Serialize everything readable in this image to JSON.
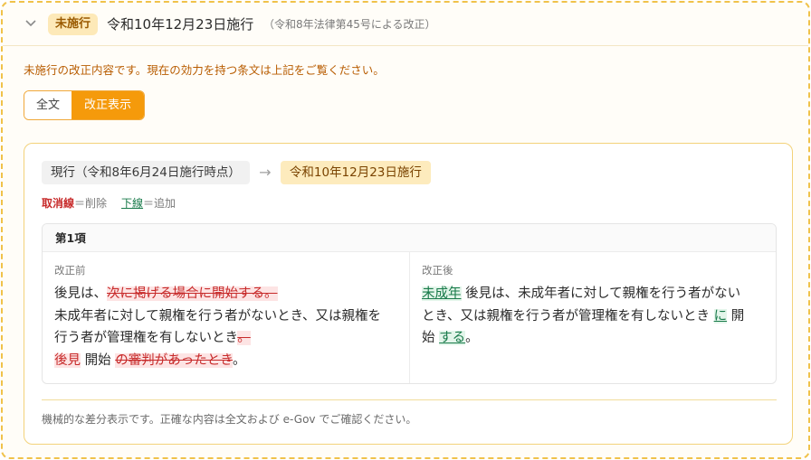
{
  "header": {
    "status_badge": "未施行",
    "title": "令和10年12月23日施行",
    "note": "（令和8年法律第45号による改正）"
  },
  "notice": "未施行の改正内容です。現在の効力を持つ条文は上記をご覧ください。",
  "view_toggle": {
    "full_label": "全文",
    "diff_label": "改正表示",
    "selected": "改正表示"
  },
  "comparison": {
    "current_label": "現行（令和8年6月24日施行時点）",
    "arrow": "→",
    "new_label": "令和10年12月23日施行"
  },
  "legend": {
    "deleted_word": "取消線",
    "deleted_meaning": "＝削除",
    "added_word": "下線",
    "added_meaning": "＝追加"
  },
  "paragraph": {
    "title": "第1項",
    "before": {
      "label": "改正前",
      "line1_a": "後見は、",
      "line1_del": "次に掲げる場合に開始する。",
      "line2": "未成年者に対して親権を行う者がないとき、又は親権を",
      "line3_a": "行う者が管理権を有しないとき",
      "line3_del": "。",
      "line4_del1": "後見",
      "line4_mid": "開始",
      "line4_del2": "の審判があったとき",
      "line4_end": "。"
    },
    "after": {
      "label": "改正後",
      "add1": "未成年",
      "text1": "後見は、未成年者に対して親権を行う者がない",
      "text2": "とき、又は親権を行う者が管理権を有しないとき",
      "add2": "に",
      "text3": "開",
      "text4": "始",
      "add3": "する",
      "end": "。"
    }
  },
  "footnote": "機械的な差分表示です。正確な内容は全文および e-Gov でご確認ください。"
}
